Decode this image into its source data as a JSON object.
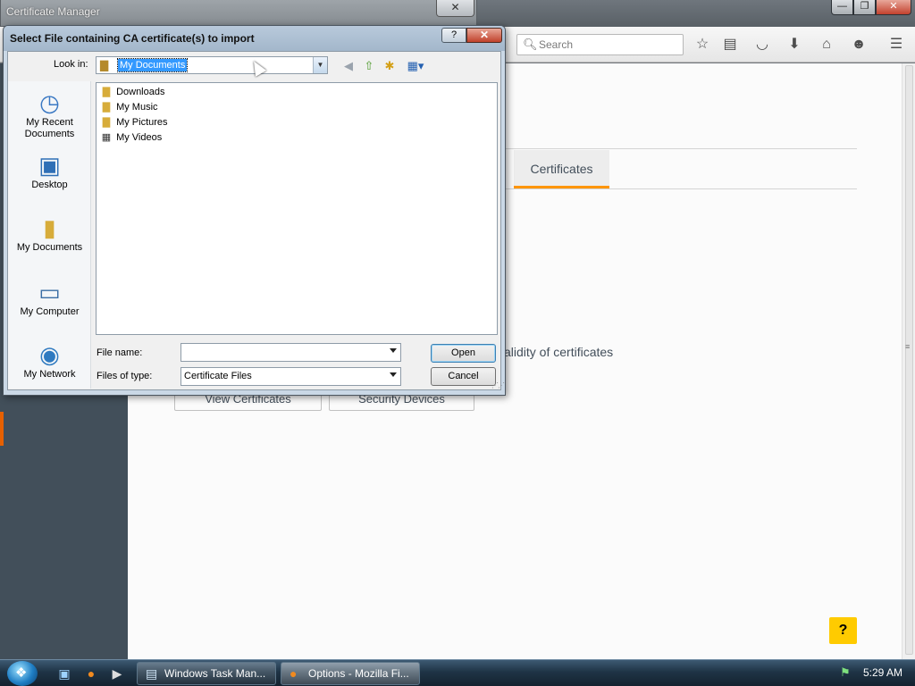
{
  "firefox": {
    "window_min": "—",
    "window_max": "❐",
    "window_close": "✕",
    "search_placeholder": "Search",
    "icons": [
      "star-icon",
      "reading-list-icon",
      "pocket-icon",
      "download-icon",
      "home-icon",
      "hello-icon",
      "menu-icon"
    ],
    "tab_certificates": "Certificates",
    "validity_text": "alidity of certificates",
    "view_certificates_btn": "View Certificates",
    "security_devices_btn": "Security Devices",
    "help_btn": "?"
  },
  "cert_manager": {
    "title": "Certificate Manager",
    "close": "✕"
  },
  "dialog": {
    "title": "Select File containing CA certificate(s) to import",
    "help_btn": "?",
    "close_btn": "✕",
    "lookin_label": "Look in:",
    "lookin_value": "My Documents",
    "places": [
      {
        "label": "My Recent Documents",
        "icon": "recent-documents-icon"
      },
      {
        "label": "Desktop",
        "icon": "desktop-icon"
      },
      {
        "label": "My Documents",
        "icon": "my-documents-icon"
      },
      {
        "label": "My Computer",
        "icon": "my-computer-icon"
      },
      {
        "label": "My Network",
        "icon": "my-network-icon"
      }
    ],
    "files": [
      {
        "name": "Downloads"
      },
      {
        "name": "My Music"
      },
      {
        "name": "My Pictures"
      },
      {
        "name": "My Videos"
      }
    ],
    "filename_label": "File name:",
    "filename_value": "",
    "filetype_label": "Files of type:",
    "filetype_value": "Certificate Files",
    "open_btn": "Open",
    "cancel_btn": "Cancel"
  },
  "taskbar": {
    "tasks": [
      {
        "label": "Windows Task Man...",
        "icon": "task-manager-icon"
      },
      {
        "label": "Options - Mozilla Fi...",
        "icon": "firefox-icon"
      }
    ],
    "clock": "5:29 AM"
  },
  "colors": {
    "accent_orange": "#ff9500",
    "help_yellow": "#ffcb00",
    "selection_blue": "#3399ff"
  }
}
